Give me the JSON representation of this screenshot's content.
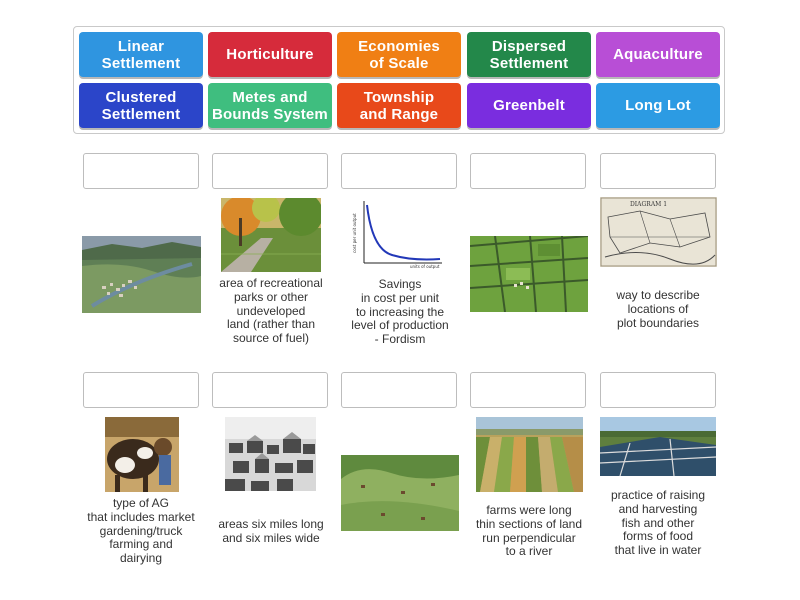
{
  "tiles": [
    {
      "label": "Linear\nSettlement",
      "color": "#2f95e0"
    },
    {
      "label": "Horticulture",
      "color": "#d62b3b"
    },
    {
      "label": "Economies\nof Scale",
      "color": "#f07f14"
    },
    {
      "label": "Dispersed\nSettlement",
      "color": "#23884a"
    },
    {
      "label": "Aquaculture",
      "color": "#b84ed6"
    },
    {
      "label": "Clustered\nSettlement",
      "color": "#2b45c9"
    },
    {
      "label": "Metes and\nBounds System",
      "color": "#3fbe7f"
    },
    {
      "label": "Township\nand Range",
      "color": "#e8491a"
    },
    {
      "label": "Greenbelt",
      "color": "#7a2ddf"
    },
    {
      "label": "Long Lot",
      "color": "#2c9be3"
    }
  ],
  "cards": [
    {
      "caption": "",
      "image": "aerial valley village"
    },
    {
      "caption": "area of recreational\nparks or other\nundeveloped\nland (rather than\nsource of fuel)",
      "image": "park path with trees"
    },
    {
      "caption": "Savings\nin cost per unit\nto increasing the\nlevel of production\n- Fordism",
      "image": "cost curve graph"
    },
    {
      "caption": "",
      "image": "green fields with hedgerows"
    },
    {
      "caption": "way to describe\nlocations of\nplot boundaries",
      "image": "hand drawn plot map"
    },
    {
      "caption": "type of AG\nthat includes market\ngardening/truck\nfarming and\ndairying",
      "image": "dairy cow"
    },
    {
      "caption": "areas six miles long\nand six miles wide",
      "image": "black and white town"
    },
    {
      "caption": "",
      "image": "hillside meadow with scattered houses"
    },
    {
      "caption": "farms were long\nthin sections of land\nrun perpendicular\nto a river",
      "image": "long lot farmland"
    },
    {
      "caption": "practice of raising\nand harvesting\nfish and other\nforms of food\nthat live in water",
      "image": "fish farm ponds"
    }
  ],
  "graph": {
    "ylabel": "cost per unit output",
    "xlabel": "units of output"
  },
  "diagram": {
    "title": "DIAGRAM 1"
  }
}
